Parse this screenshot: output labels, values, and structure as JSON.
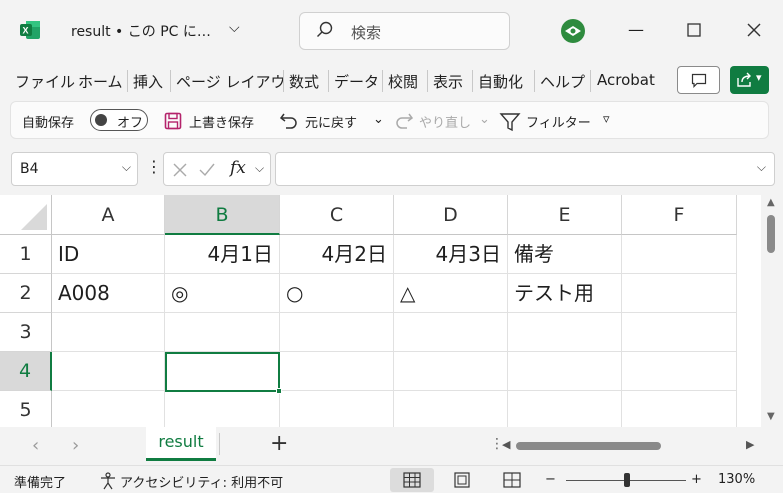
{
  "window": {
    "title": "result • この PC に…",
    "search_placeholder": "検索"
  },
  "ribbon_tabs": [
    "ファイル",
    "ホーム",
    "挿入",
    "ページ レイアウ",
    "数式",
    "データ",
    "校閲",
    "表示",
    "自動化",
    "ヘルプ",
    "Acrobat"
  ],
  "qat": {
    "autosave_label": "自動保存",
    "autosave_state": "オフ",
    "save_label": "上書き保存",
    "undo_label": "元に戻す",
    "redo_label": "やり直し",
    "filter_label": "フィルター"
  },
  "formula_bar": {
    "name_box": "B4",
    "fx_label": "fx",
    "formula": ""
  },
  "grid": {
    "columns": [
      "A",
      "B",
      "C",
      "D",
      "E",
      "F"
    ],
    "rows": [
      "1",
      "2",
      "3",
      "4",
      "5"
    ],
    "selected_column": "B",
    "selected_row": "4",
    "cells": {
      "A1": "ID",
      "B1": "4月1日",
      "C1": "4月2日",
      "D1": "4月3日",
      "E1": "備考",
      "A2": "A008",
      "B2": "◎",
      "C2": "○",
      "D2": "△",
      "E2": "テスト用"
    }
  },
  "sheets": {
    "active": "result"
  },
  "status": {
    "ready": "準備完了",
    "accessibility": "アクセシビリティ: 利用不可",
    "zoom": "130%",
    "zoom_minus": "−",
    "zoom_plus": "+"
  },
  "colors": {
    "accent": "#107c41",
    "header_selected": "#d9d9d9"
  }
}
